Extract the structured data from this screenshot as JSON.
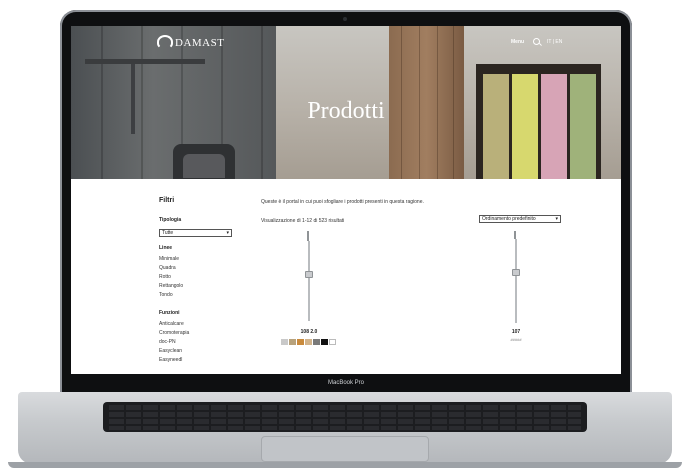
{
  "device": {
    "label": "MacBook Pro"
  },
  "header": {
    "logo": "DAMAST",
    "menu_label": "Menu",
    "lang_label": "IT | EN"
  },
  "hero": {
    "title": "Prodotti"
  },
  "sidebar": {
    "title": "Filtri",
    "tipologia_label": "Tipologia",
    "tipologia_value": "Tutte",
    "linee_label": "Linee",
    "linee": [
      "Minimale",
      "Quadra",
      "Rotto",
      "Rettangolo",
      "Tondo"
    ],
    "funzioni_label": "Funzioni",
    "funzioni": [
      "Anticalcare",
      "Cromoterapia",
      "doc-PN",
      "Easyclean",
      "Easyneedl"
    ]
  },
  "main": {
    "intro": "Queste è il portal in cui puoi sfogliare i prodotti presenti in questa ragione.",
    "count": "Visualizzazione di 1-12 di 523 risultati",
    "sort_value": "Ordinamento predefinito"
  },
  "products": [
    {
      "code": "108 2.0",
      "swatches": [
        "#c9c9c9",
        "#b8a27c",
        "#c98a3c",
        "#d2b48c",
        "#7a7a7a",
        "#111111",
        "#ffffff"
      ]
    },
    {
      "code": "107",
      "subtext": "#####"
    }
  ],
  "colors": {
    "accent": "#1c1d20",
    "hero_text": "#ffffff"
  }
}
